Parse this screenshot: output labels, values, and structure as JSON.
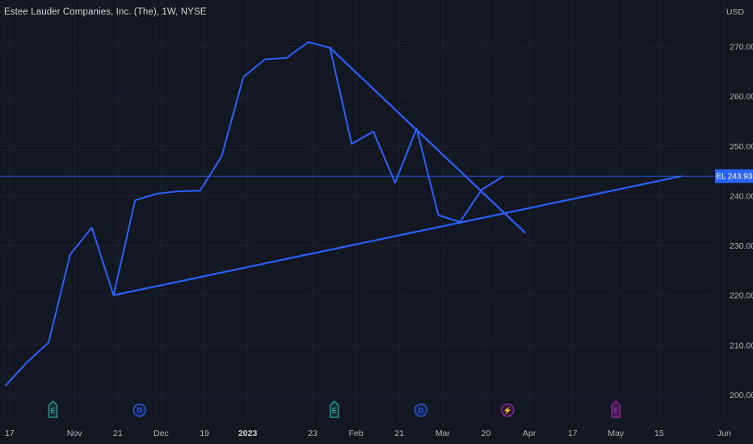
{
  "header": {
    "symbol_title": "Estee Lauder Companies, Inc. (The), 1W, NYSE",
    "currency": "USD"
  },
  "colors": {
    "background": "#131722",
    "grid": "#1e222d",
    "line": "#2962ff",
    "price_line": "#2962ff",
    "earnings": "#26a69a",
    "dividend": "#2962ff",
    "split": "#9c27b0"
  },
  "chart_data": {
    "type": "line",
    "title": "Estee Lauder Companies, Inc. (The), 1W, NYSE",
    "ylabel": "USD",
    "ylim": [
      196.5,
      284.5
    ],
    "y_ticks": [
      200,
      210,
      220,
      230,
      240,
      250,
      260,
      270
    ],
    "y_tick_labels": [
      "200.00",
      "210.00",
      "220.00",
      "230.00",
      "240.00",
      "250.00",
      "260.00",
      "270.00"
    ],
    "grid": true,
    "x_ticks": [
      {
        "label": "17",
        "week": 0.2,
        "bold": false
      },
      {
        "label": "Nov",
        "week": 3.2,
        "bold": false
      },
      {
        "label": "21",
        "week": 5.2,
        "bold": false
      },
      {
        "label": "Dec",
        "week": 7.2,
        "bold": false
      },
      {
        "label": "19",
        "week": 9.2,
        "bold": false
      },
      {
        "label": "2023",
        "week": 11.2,
        "bold": true
      },
      {
        "label": "23",
        "week": 14.2,
        "bold": false
      },
      {
        "label": "Feb",
        "week": 16.2,
        "bold": false
      },
      {
        "label": "21",
        "week": 18.2,
        "bold": false
      },
      {
        "label": "Mar",
        "week": 20.2,
        "bold": false
      },
      {
        "label": "20",
        "week": 22.2,
        "bold": false
      },
      {
        "label": "Apr",
        "week": 24.2,
        "bold": false
      },
      {
        "label": "17",
        "week": 26.2,
        "bold": false
      },
      {
        "label": "May",
        "week": 28.2,
        "bold": false
      },
      {
        "label": "15",
        "week": 30.2,
        "bold": false
      },
      {
        "label": "Jun",
        "week": 33.2,
        "bold": false
      }
    ],
    "series": [
      {
        "values": [
          {
            "week": 0,
            "y": 201.8
          },
          {
            "week": 1,
            "y": 206.5
          },
          {
            "week": 2,
            "y": 210.5
          },
          {
            "week": 3,
            "y": 228.2
          },
          {
            "week": 4,
            "y": 233.6
          },
          {
            "week": 5,
            "y": 220.0
          },
          {
            "week": 6,
            "y": 239.1
          },
          {
            "week": 7,
            "y": 240.4
          },
          {
            "week": 8,
            "y": 240.9
          },
          {
            "week": 9,
            "y": 241.0
          },
          {
            "week": 10,
            "y": 248.0
          },
          {
            "week": 11,
            "y": 263.9
          },
          {
            "week": 12,
            "y": 267.4
          },
          {
            "week": 13,
            "y": 267.7
          },
          {
            "week": 14,
            "y": 270.9
          },
          {
            "week": 15,
            "y": 269.7
          },
          {
            "week": 16,
            "y": 250.4
          },
          {
            "week": 17,
            "y": 252.9
          },
          {
            "week": 18,
            "y": 242.6
          },
          {
            "week": 19,
            "y": 253.5
          },
          {
            "week": 20,
            "y": 236.1
          },
          {
            "week": 21,
            "y": 234.7
          },
          {
            "week": 22,
            "y": 241.2
          },
          {
            "week": 23,
            "y": 243.93
          }
        ]
      }
    ],
    "trendlines": [
      {
        "from": {
          "week": 5,
          "y": 220.0
        },
        "to": {
          "week": 31.2,
          "y": 243.9
        }
      },
      {
        "from": {
          "week": 15,
          "y": 269.7
        },
        "to": {
          "week": 24,
          "y": 232.6
        }
      }
    ],
    "last_price": 243.93,
    "price_label": {
      "symbol": "EL",
      "value": "243.93"
    },
    "events": [
      {
        "type": "earnings",
        "glyph": "E",
        "week": 2.2
      },
      {
        "type": "dividend",
        "glyph": "D",
        "week": 6.2
      },
      {
        "type": "earnings",
        "glyph": "E",
        "week": 15.2
      },
      {
        "type": "dividend",
        "glyph": "D",
        "week": 19.2
      },
      {
        "type": "split",
        "glyph": "⚡",
        "week": 23.2
      },
      {
        "type": "earnings-future",
        "glyph": "E",
        "week": 28.2
      }
    ]
  }
}
